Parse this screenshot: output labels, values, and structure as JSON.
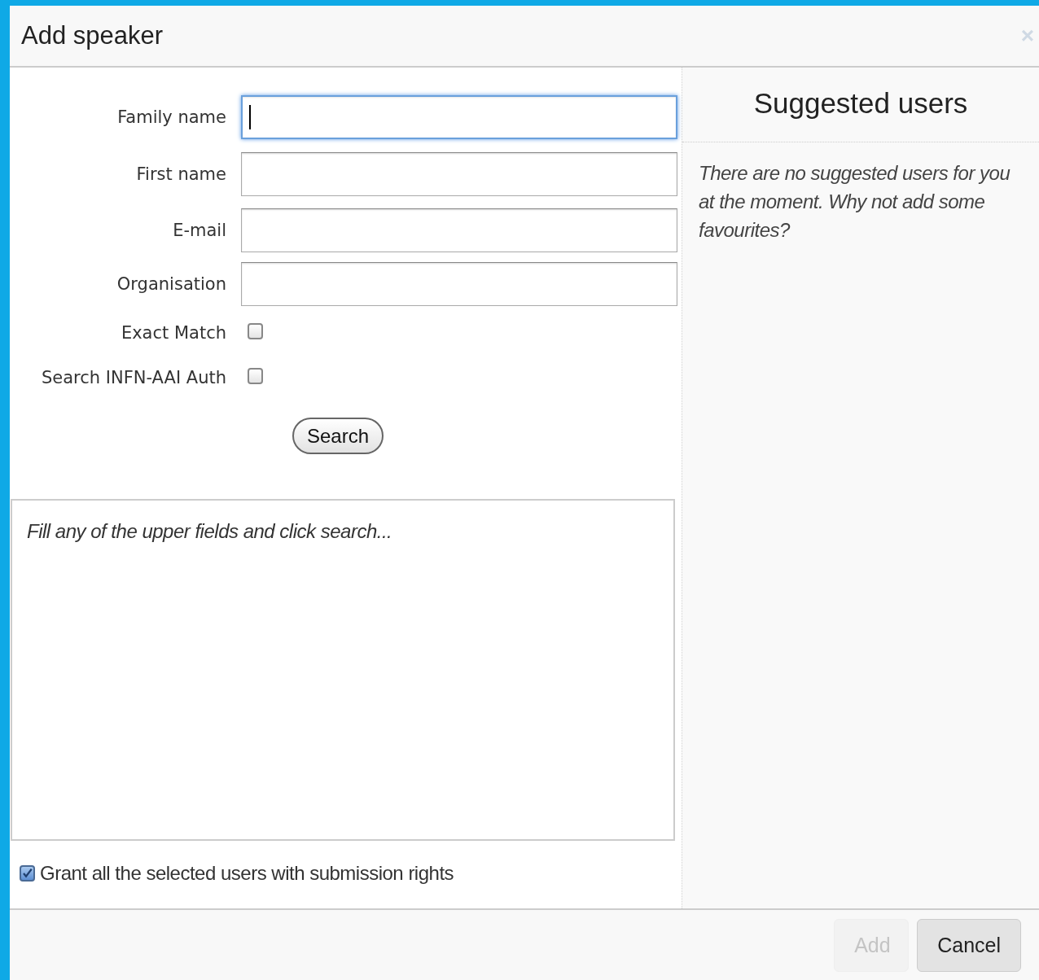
{
  "window": {
    "title": "Add speaker",
    "close": "×"
  },
  "form": {
    "fields": [
      {
        "label": "Family name",
        "focused": true
      },
      {
        "label": "First name",
        "focused": false
      },
      {
        "label": "E-mail",
        "focused": false
      },
      {
        "label": "Organisation",
        "focused": false
      }
    ],
    "options": [
      {
        "label": "Exact Match",
        "checked": false
      },
      {
        "label": "Search INFN-AAI Auth",
        "checked": false
      }
    ],
    "search_button": "Search",
    "results_hint": "Fill any of the upper fields and click search...",
    "grant": {
      "label": "Grant all the selected users with submission rights",
      "checked": true
    }
  },
  "suggested": {
    "title": "Suggested users",
    "message": "There are no suggested users for you at the moment. Why not add some favourites?"
  },
  "buttons": [
    {
      "label": "Add",
      "disabled": true
    },
    {
      "label": "Cancel",
      "disabled": false
    }
  ]
}
